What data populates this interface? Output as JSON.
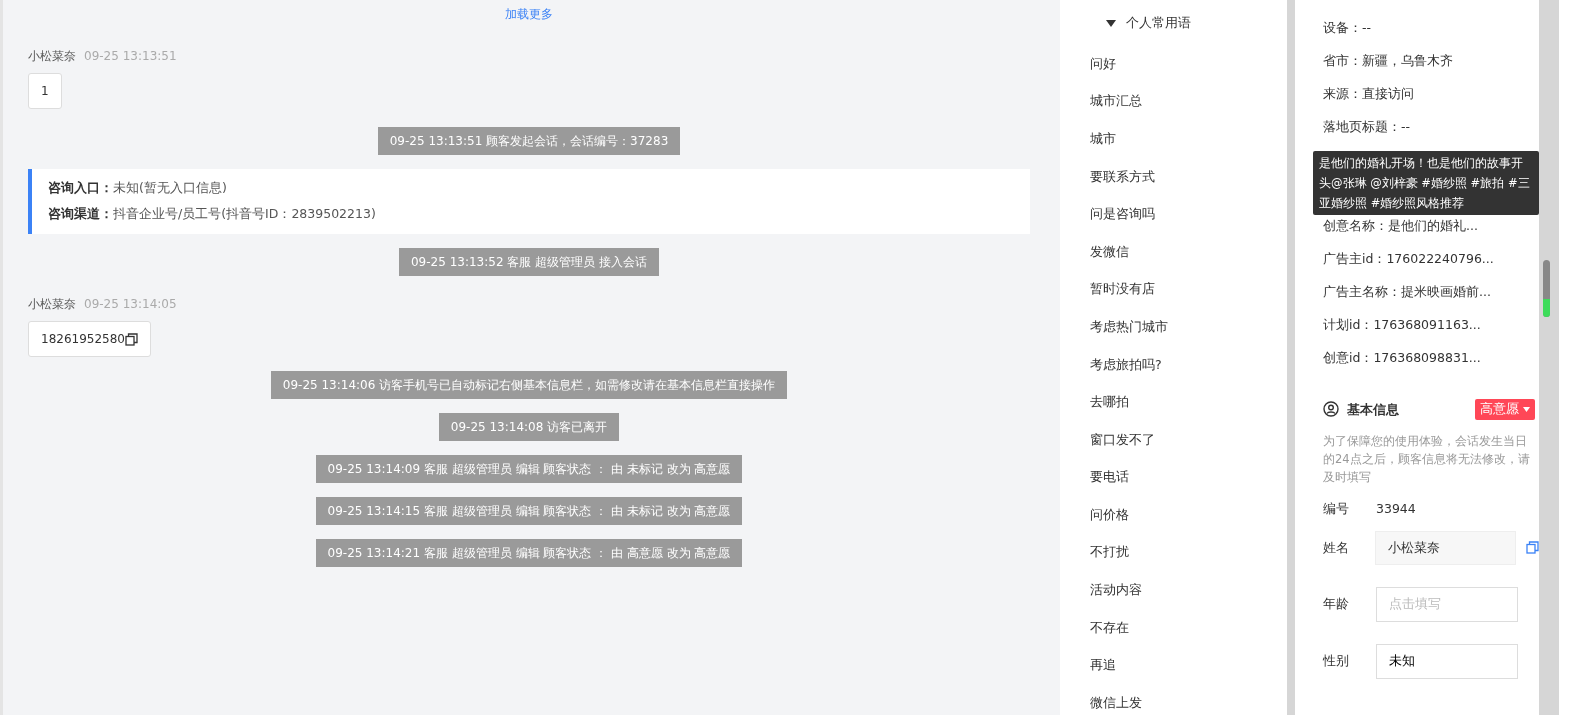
{
  "chat": {
    "load_more": "加载更多",
    "messages": [
      {
        "kind": "visitor",
        "name": "小松菜奈",
        "time": "09-25 13:13:51",
        "text": "1",
        "copyable": false
      },
      {
        "kind": "system",
        "text": "09-25 13:13:51 顾客发起会话，会话编号：37283"
      },
      {
        "kind": "entry",
        "lines": [
          {
            "label": "咨询入口：",
            "value": "未知(暂无入口信息)"
          },
          {
            "label": "咨询渠道：",
            "value": "抖音企业号/员工号(抖音号ID：2839502213)"
          }
        ]
      },
      {
        "kind": "system",
        "text": "09-25 13:13:52 客服 超级管理员 接入会话"
      },
      {
        "kind": "visitor",
        "name": "小松菜奈",
        "time": "09-25 13:14:05",
        "text": "18261952580",
        "copyable": true
      },
      {
        "kind": "system",
        "text": "09-25 13:14:06 访客手机号已自动标记右侧基本信息栏，如需修改请在基本信息栏直接操作"
      },
      {
        "kind": "system",
        "text": "09-25 13:14:08 访客已离开"
      },
      {
        "kind": "system",
        "text": "09-25 13:14:09 客服 超级管理员 编辑 顾客状态 ： 由 未标记 改为 高意愿"
      },
      {
        "kind": "system",
        "text": "09-25 13:14:15 客服 超级管理员 编辑 顾客状态 ： 由 未标记 改为 高意愿"
      },
      {
        "kind": "system",
        "text": "09-25 13:14:21 客服 超级管理员 编辑 顾客状态 ： 由 高意愿 改为 高意愿"
      }
    ]
  },
  "phrases": {
    "group": "个人常用语",
    "expanded": true,
    "items": [
      "问好",
      "城市汇总",
      "城市",
      "要联系方式",
      "问是咨询吗",
      "发微信",
      "暂时没有店",
      "考虑热门城市",
      "考虑旅拍吗?",
      "去哪拍",
      "窗口发不了",
      "要电话",
      "问价格",
      "不打扰",
      "活动内容",
      "不存在",
      "再追",
      "微信上发"
    ]
  },
  "visitor_info": {
    "rows_top": [
      "设备：--",
      "省市：新疆，乌鲁木齐",
      "来源：直接访问",
      "落地页标题：--"
    ],
    "tooltip": "是他们的婚礼开场！也是他们的故事开头@张琳 @刘梓豪 #婚纱照 #旅拍 #三亚婚纱照 #婚纱照风格推荐",
    "rows_bottom": [
      "创意名称：是他们的婚礼...",
      "广告主id：176022240796...",
      "广告主名称：提米映画婚前...",
      "计划id：176368091163...",
      "创意id：176368098831..."
    ]
  },
  "basic_info": {
    "title": "基本信息",
    "status": "高意愿",
    "note": "为了保障您的使用体验，会话发生当日的24点之后，顾客信息将无法修改，请及时填写",
    "fields": [
      {
        "kind": "text",
        "label": "编号",
        "value": "33944"
      },
      {
        "kind": "filled",
        "label": "姓名",
        "value": "小松菜奈",
        "copyable": true
      },
      {
        "kind": "input",
        "label": "年龄",
        "placeholder": "点击填写"
      },
      {
        "kind": "input",
        "label": "性别",
        "value": "未知"
      }
    ]
  }
}
